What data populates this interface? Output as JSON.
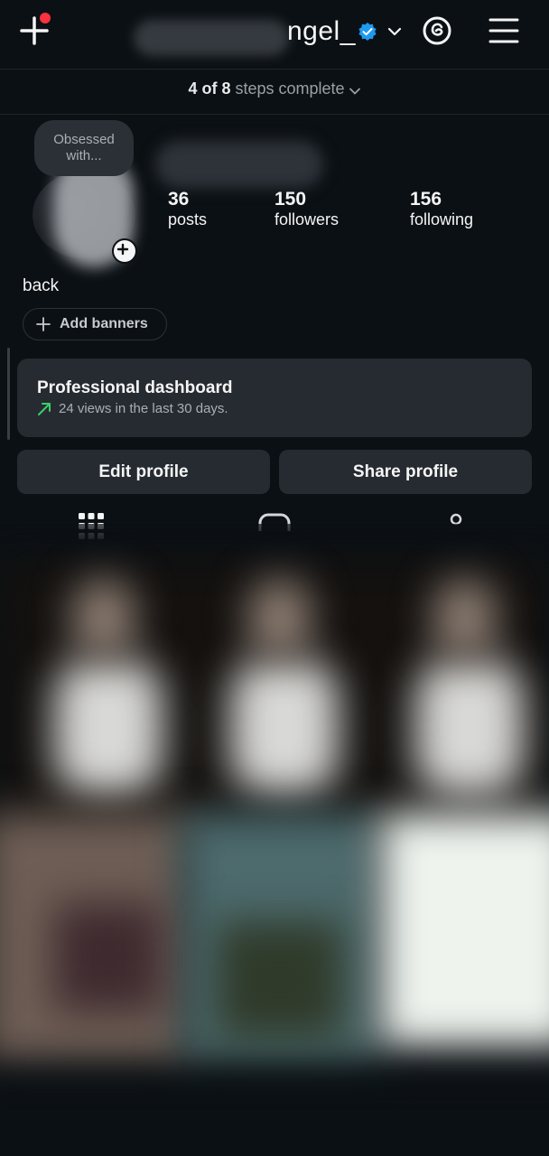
{
  "header": {
    "username_suffix": "ngel_",
    "setup_progress": {
      "completed": "4 of 8",
      "suffix": " steps complete"
    }
  },
  "profile": {
    "note": "Obsessed with...",
    "bio": "back",
    "stats": [
      {
        "value": "36",
        "label": "posts"
      },
      {
        "value": "150",
        "label": "followers"
      },
      {
        "value": "156",
        "label": "following"
      }
    ],
    "add_banners_label": "Add banners"
  },
  "dashboard": {
    "title": "Professional dashboard",
    "subtitle": "24 views in the last 30 days."
  },
  "actions": {
    "edit_profile": "Edit profile",
    "share_profile": "Share profile"
  },
  "colors": {
    "background": "#0b1014",
    "card": "#262b31",
    "accent_verified": "#1d9bf0",
    "trend_green": "#3ccf6a",
    "notification_red": "#ff3040"
  },
  "icons": {
    "create": "plus-icon",
    "verified": "verified-badge-icon",
    "threads": "threads-icon",
    "menu": "hamburger-menu-icon",
    "trend": "trend-up-arrow-icon",
    "grid": "grid-icon"
  }
}
